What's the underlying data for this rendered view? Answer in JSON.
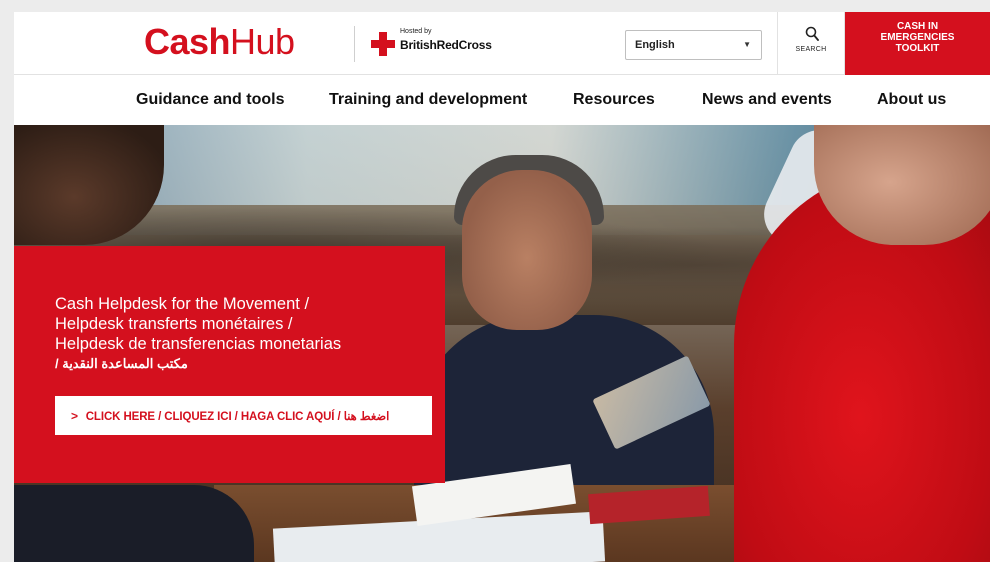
{
  "header": {
    "logo_bold": "Cash",
    "logo_light": "Hub",
    "hosted_by": "Hosted by",
    "partner": "BritishRedCross",
    "language": {
      "selected": "English"
    },
    "search_label": "SEARCH",
    "toolkit_lines": [
      "CASH IN",
      "EMERGENCIES",
      "TOOLKIT"
    ]
  },
  "nav": {
    "items": [
      {
        "label": "Guidance and tools"
      },
      {
        "label": "Training and development"
      },
      {
        "label": "Resources"
      },
      {
        "label": "News and events"
      },
      {
        "label": "About us"
      }
    ]
  },
  "hero": {
    "panel": {
      "title_lines": [
        "Cash Helpdesk for the Movement /",
        "Helpdesk transferts monétaires /",
        "Helpdesk de transferencias monetarias",
        "مكتب المساعدة النقدية /"
      ],
      "cta_label": "CLICK HERE / CLIQUEZ ICI / HAGA CLIC AQUÍ / اضغط هنا"
    }
  },
  "colors": {
    "brand_red": "#d4101e",
    "text_dark": "#111111",
    "header_bg": "#ffffff"
  },
  "icons": {
    "search": "search-icon",
    "dropdown": "chevron-down-icon",
    "cta": "chevron-right-icon",
    "partner_logo": "red-cross-icon"
  }
}
